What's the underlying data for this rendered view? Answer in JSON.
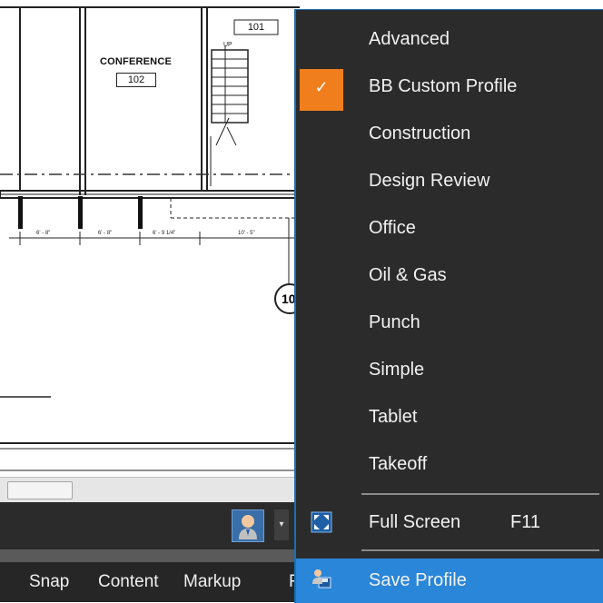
{
  "drawing": {
    "rooms": [
      {
        "name": "CONFERENCE",
        "number": "102"
      },
      {
        "name": "",
        "number": "101"
      }
    ],
    "stair_label": "UP",
    "dimensions": [
      "6' - 8\"",
      "6' - 8\"",
      "6' - 9 1/4\"",
      "10' - 5\""
    ],
    "grid_bubble": "10"
  },
  "statusbar": {
    "profile_icon": "user-profile-icon",
    "dropdown_icon": "dropdown-arrow-icon"
  },
  "tabs": [
    "Snap",
    "Content",
    "Markup",
    "F"
  ],
  "menu": {
    "profiles": [
      {
        "label": "Advanced",
        "checked": false
      },
      {
        "label": "BB Custom Profile",
        "checked": true
      },
      {
        "label": "Construction",
        "checked": false
      },
      {
        "label": "Design Review",
        "checked": false
      },
      {
        "label": "Office",
        "checked": false
      },
      {
        "label": "Oil & Gas",
        "checked": false
      },
      {
        "label": "Punch",
        "checked": false
      },
      {
        "label": "Simple",
        "checked": false
      },
      {
        "label": "Tablet",
        "checked": false
      },
      {
        "label": "Takeoff",
        "checked": false
      }
    ],
    "full_screen": {
      "label": "Full Screen",
      "shortcut": "F11",
      "icon": "fullscreen-icon"
    },
    "save_profile": {
      "label": "Save Profile",
      "icon": "save-profile-icon"
    },
    "check_mark": "✓"
  },
  "colors": {
    "menu_bg": "#2b2b2b",
    "check_accent": "#f07e1c",
    "highlight": "#2a86d8",
    "profile_button": "#3a6ea8"
  }
}
